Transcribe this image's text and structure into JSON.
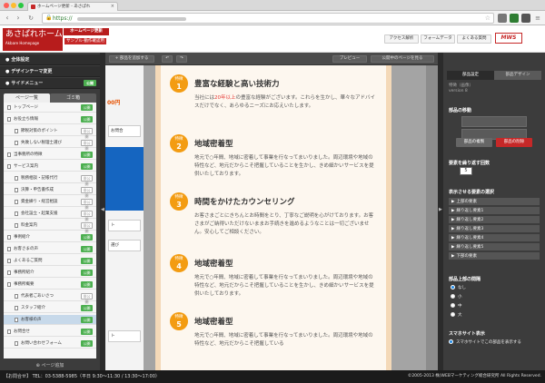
{
  "browser": {
    "tab_title": "ホームページ更新 - あさぱれ",
    "url_scheme": "https://"
  },
  "header": {
    "logo_main": "あさぱれホームページ",
    "logo_sub": "Akbare Homepage",
    "update_label": "ホームページ更新",
    "sample_badge": "サンプル-動作確認用",
    "buttons": [
      "アクセス解析",
      "フォームデータ",
      "よくある質問"
    ],
    "brand": "MWS"
  },
  "left_sidebar": {
    "rows": [
      {
        "label": "全体設定"
      },
      {
        "label": "デザインテーマ変更"
      },
      {
        "label": "サイドメニュー",
        "badge": "公開"
      }
    ],
    "tabs": [
      "ページ一覧",
      "ゴミ箱"
    ],
    "pages": [
      {
        "label": "トップページ",
        "level": 0,
        "badge": "公開",
        "state": "pub"
      },
      {
        "label": "お役立ち情報",
        "level": 0,
        "badge": "公開",
        "state": "pub"
      },
      {
        "label": "節税対策のポイント",
        "level": 1,
        "badge": "非公開",
        "state": "hide"
      },
      {
        "label": "失敗しない税理士選び",
        "level": 1,
        "badge": "非公開",
        "state": "hide"
      },
      {
        "label": "当事務所の特徴",
        "level": 0,
        "badge": "公開",
        "state": "pub"
      },
      {
        "label": "サービス案内",
        "level": 0,
        "badge": "公開",
        "state": "pub"
      },
      {
        "label": "税務相談・記帳代行",
        "level": 1,
        "badge": "非公開",
        "state": "hide"
      },
      {
        "label": "決算・申告書作成",
        "level": 1,
        "badge": "非公開",
        "state": "hide"
      },
      {
        "label": "資金繰り・経営相談",
        "level": 1,
        "badge": "非公開",
        "state": "hide"
      },
      {
        "label": "会社設立・起業支援",
        "level": 1,
        "badge": "非公開",
        "state": "hide"
      },
      {
        "label": "料金案内",
        "level": 1,
        "badge": "非公開",
        "state": "hide"
      },
      {
        "label": "事例紹介",
        "level": 0,
        "badge": "公開",
        "state": "pub"
      },
      {
        "label": "お客さまの声",
        "level": 0,
        "badge": "公開",
        "state": "pub"
      },
      {
        "label": "よくあるご質問",
        "level": 0,
        "badge": "公開",
        "state": "pub"
      },
      {
        "label": "事務所紹介",
        "level": 0,
        "badge": "公開",
        "state": "pub"
      },
      {
        "label": "事務所概要",
        "level": 0,
        "badge": "公開",
        "state": "pub"
      },
      {
        "label": "代表者ごあいさつ",
        "level": 1,
        "badge": "非公開",
        "state": "hide"
      },
      {
        "label": "スタッフ紹介",
        "level": 1,
        "badge": "公開",
        "state": "pub"
      },
      {
        "label": "お客様の声",
        "level": 1,
        "badge": "公開",
        "state": "pub",
        "selected": true
      },
      {
        "label": "お問合せ",
        "level": 0,
        "badge": "公開",
        "state": "pub"
      },
      {
        "label": "お問い合わせフォーム",
        "level": 1,
        "badge": "公開",
        "state": "pub"
      }
    ],
    "add_page": "ページ追加"
  },
  "toolbar": {
    "add_part": "+ 部品を追加する",
    "undo": "↶",
    "redo": "↷",
    "preview": "プレビュー",
    "public": "公開中のページを見る"
  },
  "canvas": {
    "bg_price": "00円",
    "bg_boxes": [
      "お問合",
      "ト",
      "選び",
      "ト"
    ],
    "features": [
      {
        "tag": "特徴",
        "num": "1",
        "title": "豊富な経験と高い技術力",
        "body_pre": "当社には",
        "body_hl": "20年以上",
        "body_post": "の豊富な経験がございます。これらを生かし、華々なアドバイスだけでなく、あらゆるニーズにお応えいたします。"
      },
      {
        "tag": "特徴",
        "num": "2",
        "title": "地域密着型",
        "body": "地元で○年間、地域に密着して事業を行なってまいりました。周辺環境や地域の特性など、地元だからこそ把握していることを生かし、きめ細かいサービスを提供いたしております。"
      },
      {
        "tag": "特徴",
        "num": "3",
        "title": "時間をかけたカウンセリング",
        "body": "お客さまごとにきちんとお時間をとり、丁寧なご説明を心がけております。お客さまがご納得いただけないままお手続きを進めるようなことは一切ございません。安心してご相談ください。"
      },
      {
        "tag": "特徴",
        "num": "4",
        "title": "地域密着型",
        "body": "地元で○年間、地域に密着して事業を行なってまいりました。周辺環境や地域の特性など、地元だからこそ把握していることを生かし、きめ細かいサービスを提供いたしております。"
      },
      {
        "tag": "特徴",
        "num": "5",
        "title": "地域密着型",
        "body": "地元で○年間、地域に密着して事業を行なってまいりました。周辺環境や地域の特性など、地元だからこそ把握している"
      }
    ]
  },
  "right_sidebar": {
    "tabs": [
      "部品設定",
      "部品デザイン"
    ],
    "info": [
      "特徴（画像）",
      "version 8"
    ],
    "move_label": "部品の移動",
    "copy_btn": "部品の複製",
    "delete_btn": "部品の削除",
    "repeat_label": "要素を繰り返す回数",
    "repeat_value": "5",
    "select_label": "表示させる要素の選択",
    "items": [
      "上部の要素",
      "繰り返し要素1",
      "繰り返し要素2",
      "繰り返し要素3",
      "繰り返し要素4",
      "繰り返し要素5",
      "下部の要素"
    ],
    "spacing_label": "部品上部の間隔",
    "radios": [
      {
        "label": "なし",
        "on": true
      },
      {
        "label": "小",
        "on": false
      },
      {
        "label": "中",
        "on": false
      },
      {
        "label": "大",
        "on": false
      }
    ],
    "sp_label": "スマホサイト表示",
    "sp_text": "スマホサイトでこの部品を表示する"
  },
  "footer": {
    "left": "【お問合せ】 TEL：03-5388-5985（平日 9:30〜11:30 / 13:30〜17:00）",
    "right": "©2005-2013 株)WEBマーケティング総合研究所 All Rights Reserved."
  }
}
